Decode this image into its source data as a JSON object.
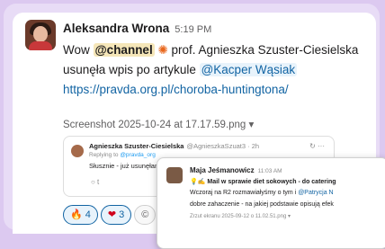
{
  "message": {
    "author": "Aleksandra Wrona",
    "time": "5:19 PM",
    "text_1": "Wow ",
    "channel_mention": "@channel",
    "text_2": " prof. Agnieszka Szuster-Ciesielska usunęła wpis po artykule ",
    "user_mention": "@Kacper Wąsiak",
    "link": "https://pravda.org.pl/choroba-huntingtona/",
    "file_name": "Screenshot 2025-10-24 at 17.17.59.png",
    "file_dropdown": "▾",
    "sparkle_glyph": "✺"
  },
  "quoted_post": {
    "author": "Agnieszka Szuster-Ciesielska",
    "handle": "@AgnieszkaSzuat3 · 2h",
    "replying_prefix": "Replying to ",
    "replying_to": "@pravda_org",
    "text": "Słusznie - już usunęłam wpis.",
    "icons": "↻ ···",
    "footer": "○        t"
  },
  "reactions": [
    {
      "emoji": "🔥",
      "count": "4"
    },
    {
      "emoji": "❤",
      "count": "3"
    },
    {
      "emoji": "©",
      "count": ""
    }
  ],
  "overlay": {
    "author": "Maja Jeśmanowicz",
    "time": "11:03 AM",
    "line1": "💡✍ Mail w sprawie diet sokowych - do catering",
    "line2_a": "Wczoraj na R2 rozmawiałyśmy o tym i ",
    "line2_b": "@Patrycja N",
    "line3": "dobre zahaczenie - na jakiej podstawie opisują efek",
    "file": "Zrzut ekranu 2025-09-12 o 11.02.51.png ▾"
  }
}
